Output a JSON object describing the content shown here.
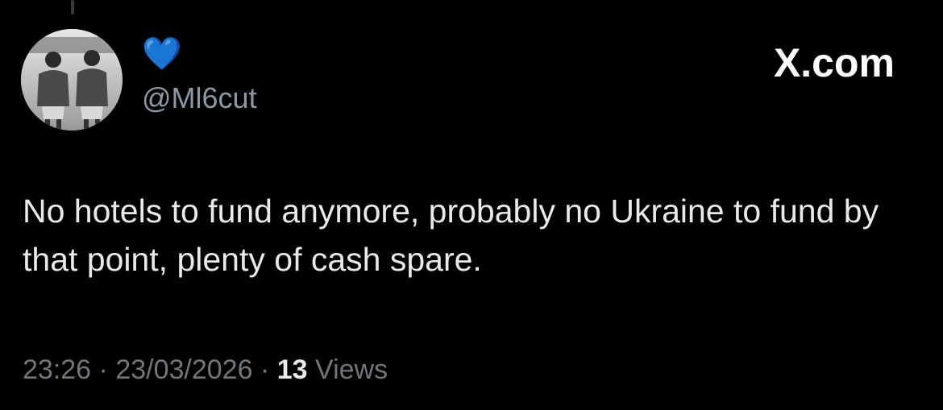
{
  "author": {
    "display_name": "💙",
    "handle": "@Ml6cut"
  },
  "brand": "X.com",
  "tweet": {
    "text": "No hotels to fund anymore, probably no Ukraine to fund by that point, plenty of cash spare."
  },
  "meta": {
    "time": "23:26",
    "separator": "·",
    "date": "23/03/2026",
    "views_count": "13",
    "views_label": "Views"
  },
  "colors": {
    "background": "#000000",
    "text": "#e7e9ea",
    "muted": "#71767b",
    "heart": "#1d9bf0"
  },
  "icons": {
    "avatar": "profile-photo"
  }
}
